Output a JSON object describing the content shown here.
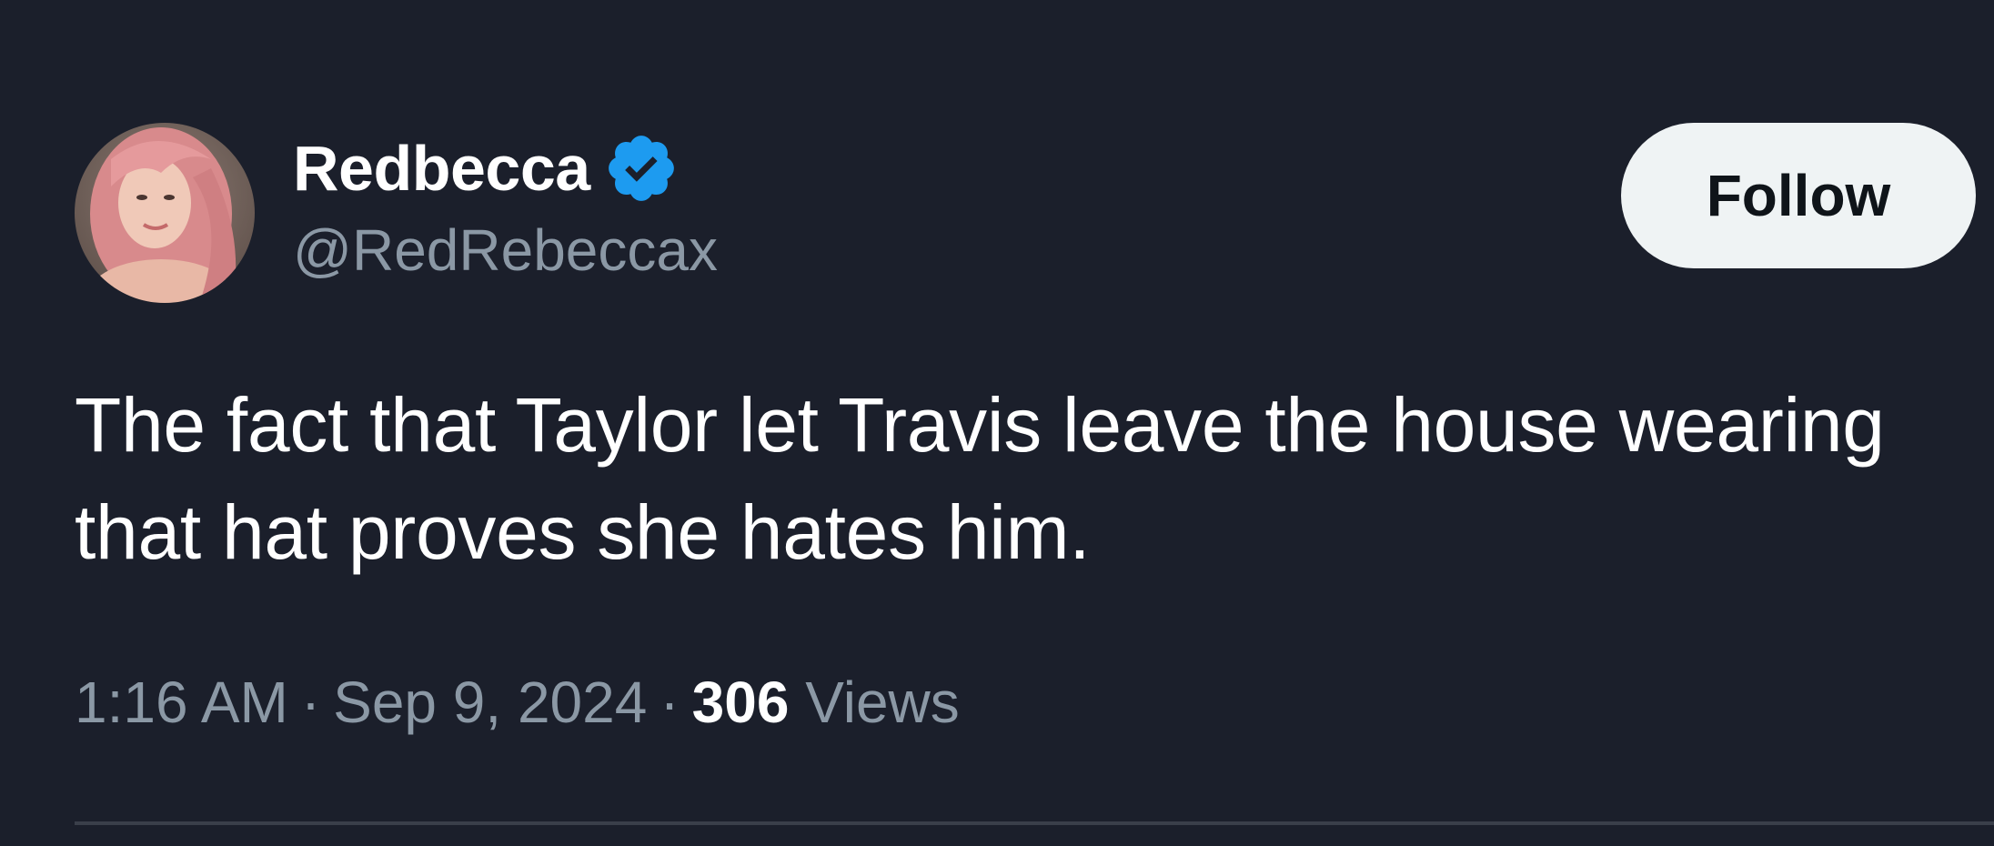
{
  "author": {
    "display_name": "Redbecca",
    "handle": "@RedRebeccax",
    "verified": true,
    "verified_icon": "verified-badge-icon",
    "avatar_icon": "profile-avatar"
  },
  "follow_button": {
    "label": "Follow"
  },
  "tweet": {
    "text": "The fact that Taylor let Travis leave the house wearing\nthat hat proves she hates him."
  },
  "meta": {
    "time": "1:16 AM",
    "separator": "·",
    "date": "Sep 9, 2024",
    "views_count": "306",
    "views_label": "Views"
  },
  "colors": {
    "background": "#1b1f2b",
    "text_primary": "#ffffff",
    "text_secondary": "#8b98a5",
    "verified_blue": "#1d9bf0",
    "button_bg": "#eff3f4",
    "button_text": "#0f1419",
    "divider": "#3a3f4a"
  }
}
